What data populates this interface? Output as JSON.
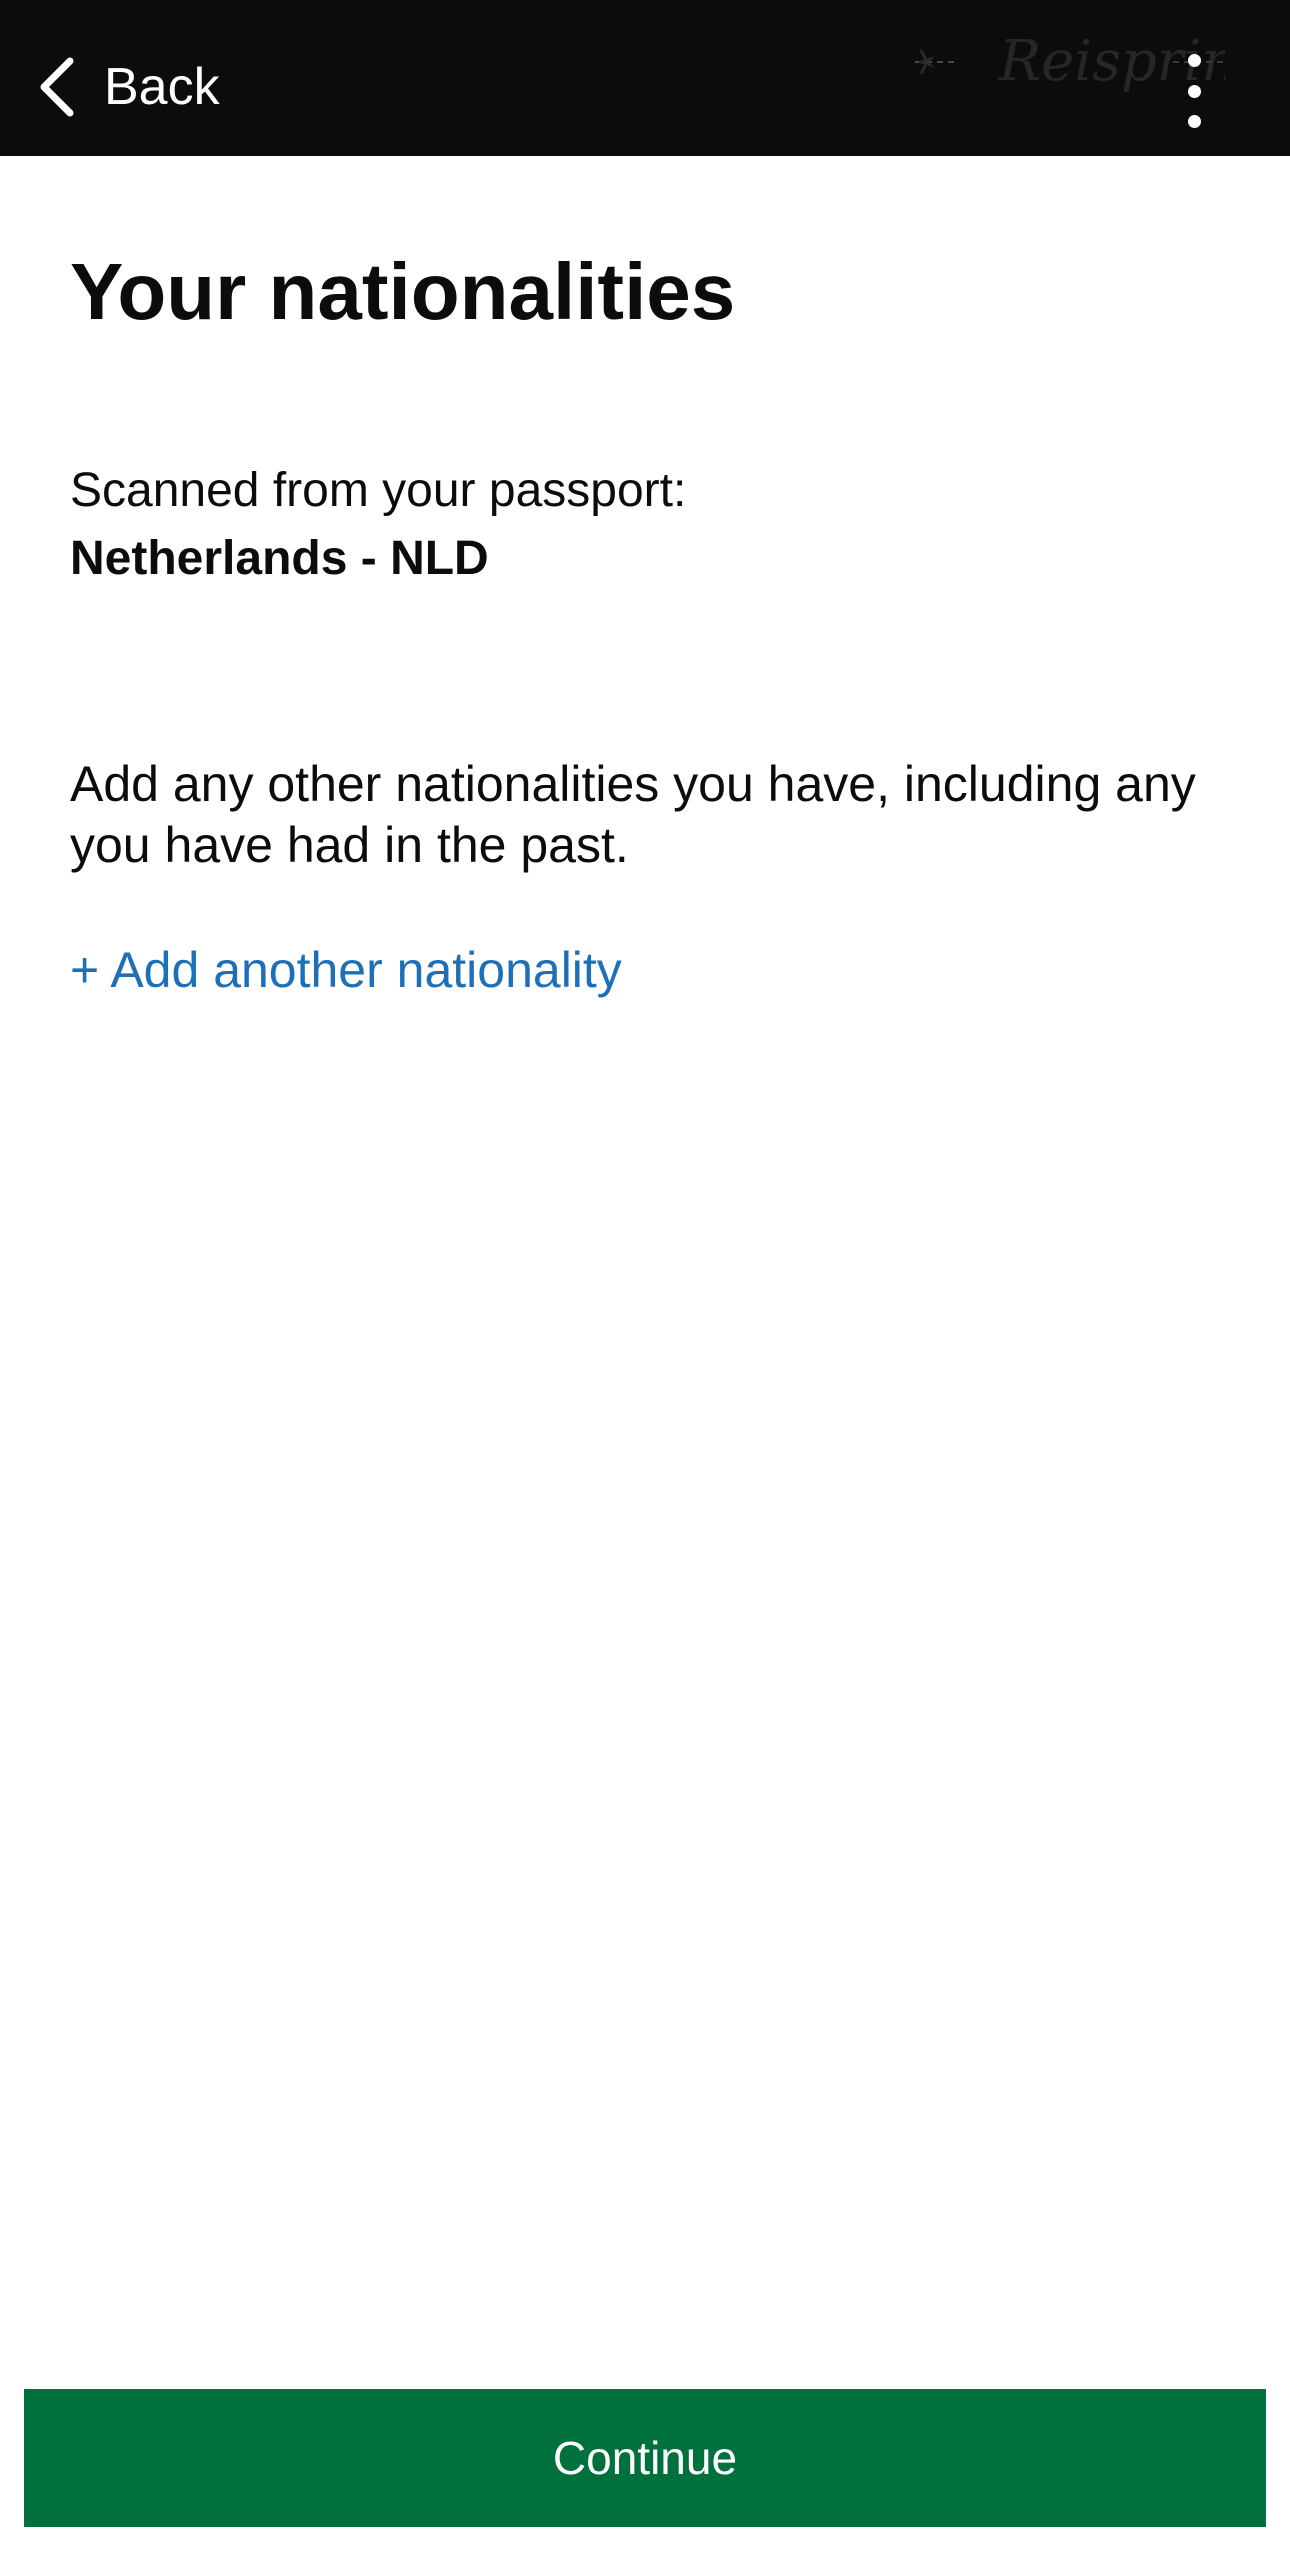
{
  "header": {
    "back_label": "Back",
    "watermark_text": "Reisprins",
    "background_color": "#0b0c0c",
    "menu_icon": "more-vertical-icon"
  },
  "main": {
    "title": "Your nationalities",
    "scanned_label": "Scanned from your passport:",
    "scanned_nationality": "Netherlands - NLD",
    "instructions": "Add any other nationalities you have, including any you have had in the past.",
    "add_link_label": "+ Add another nationality",
    "link_color": "#1d70b8"
  },
  "footer": {
    "continue_label": "Continue",
    "button_color": "#00703c"
  }
}
